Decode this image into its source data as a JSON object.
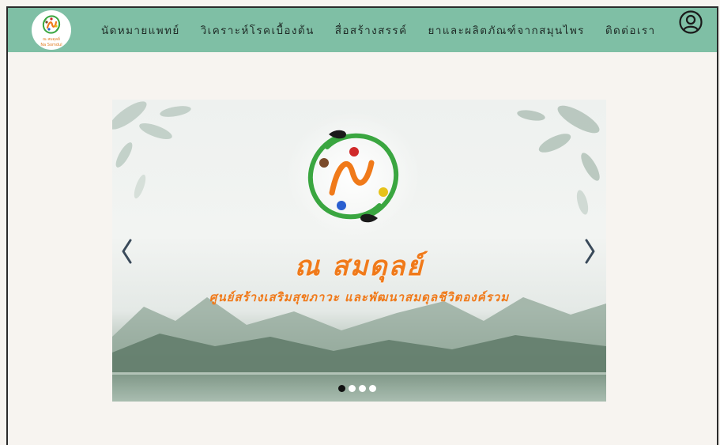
{
  "navbar": {
    "logo_caption_1": "ณ สมดุลย์",
    "logo_caption_2": "Na Somdul",
    "items": [
      {
        "label": "นัดหมายแพทย์"
      },
      {
        "label": "วิเคราะห์โรคเบื้องต้น"
      },
      {
        "label": "สื่อสร้างสรรค์"
      },
      {
        "label": "ยาและผลิตภัณฑ์จากสมุนไพร"
      },
      {
        "label": "ติดต่อเรา"
      }
    ],
    "user_icon": "user-circle-icon"
  },
  "carousel": {
    "title": "ณ สมดุลย์",
    "subtitle": "ศูนย์สร้างเสริมสุขภาวะ และพัฒนาสมดุลชีวิตองค์รวม",
    "prev_icon": "chevron-left-icon",
    "next_icon": "chevron-right-icon",
    "slide_count": 4,
    "active_index": 0
  },
  "colors": {
    "nav_bg": "#7fbfa5",
    "page_bg": "#f7f4f0",
    "accent_orange": "#f07a1a",
    "logo_green": "#3aa640"
  }
}
